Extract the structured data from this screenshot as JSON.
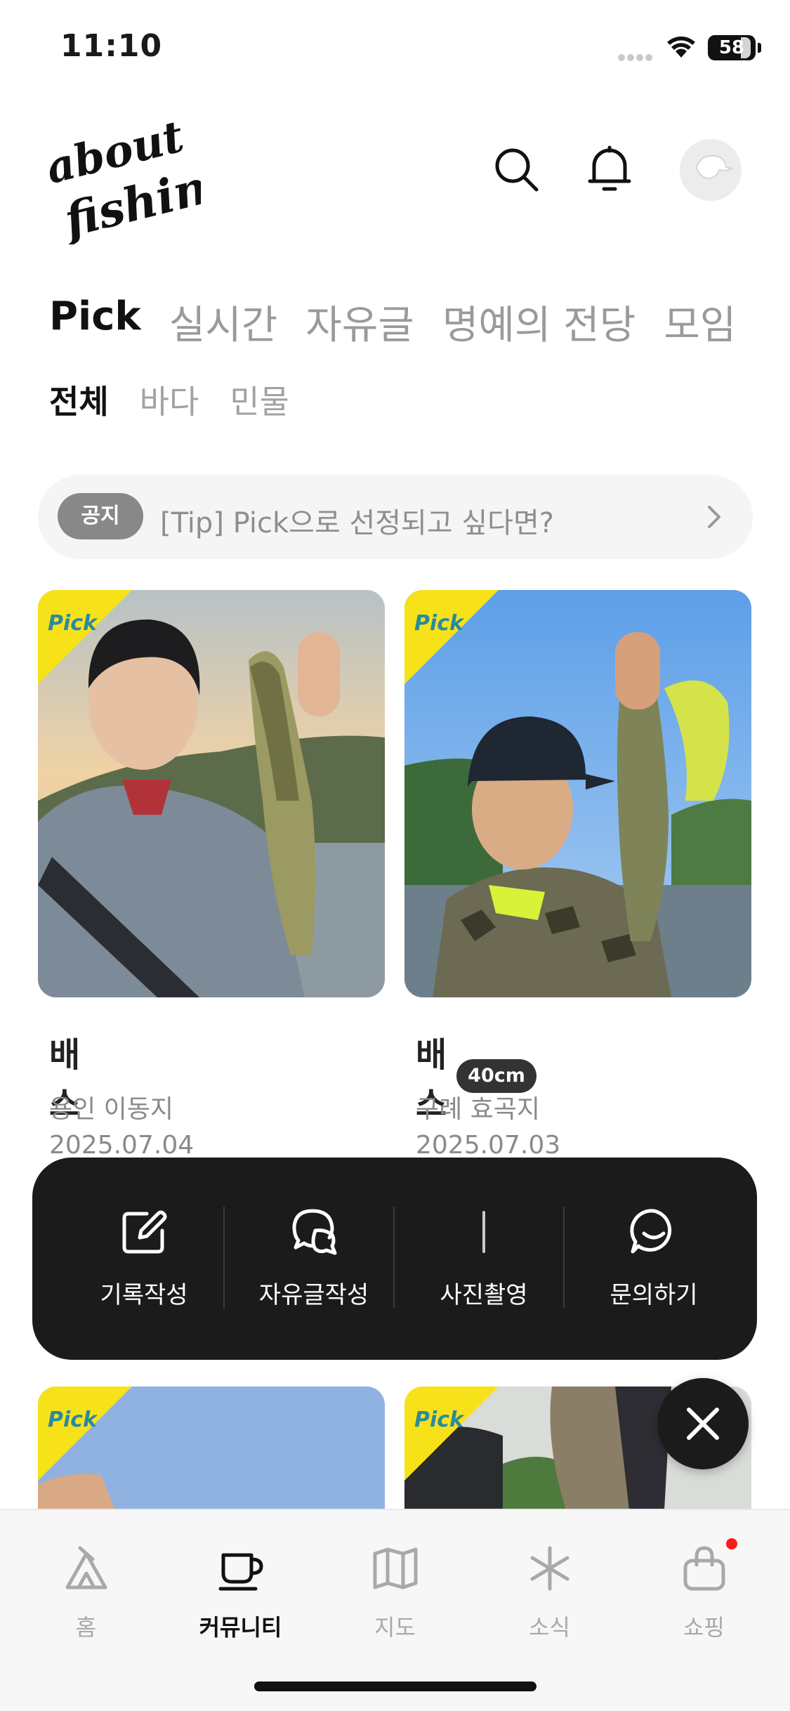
{
  "status": {
    "time": "11:10",
    "battery": "58"
  },
  "header": {
    "logo_line1": "about",
    "logo_line2": "fishing"
  },
  "main_tabs": [
    {
      "label": "Pick",
      "active": true
    },
    {
      "label": "실시간",
      "active": false
    },
    {
      "label": "자유글",
      "active": false
    },
    {
      "label": "명예의 전당",
      "active": false
    },
    {
      "label": "모임",
      "active": false
    }
  ],
  "sub_tabs": [
    {
      "label": "전체",
      "active": true
    },
    {
      "label": "바다",
      "active": false
    },
    {
      "label": "민물",
      "active": false
    }
  ],
  "notice": {
    "badge": "공지",
    "text": "[Tip] Pick으로 선정되고 싶다면?"
  },
  "cards": [
    {
      "pick": "Pick",
      "title": "배스",
      "size": "",
      "location": "용인 이동지",
      "date": "2025.07.04"
    },
    {
      "pick": "Pick",
      "title": "배스",
      "size": "40cm",
      "location": "구례 효곡지",
      "date": "2025.07.03"
    },
    {
      "pick": "Pick"
    },
    {
      "pick": "Pick"
    }
  ],
  "action_menu": [
    {
      "label": "기록작성",
      "icon": "edit-icon"
    },
    {
      "label": "자유글작성",
      "icon": "chat-bubble-icon"
    },
    {
      "label": "사진촬영",
      "icon": "camera-icon"
    },
    {
      "label": "문의하기",
      "icon": "smile-chat-icon"
    }
  ],
  "bottom_nav": [
    {
      "label": "홈",
      "icon": "tent-icon",
      "active": false
    },
    {
      "label": "커뮤니티",
      "icon": "cup-icon",
      "active": true
    },
    {
      "label": "지도",
      "icon": "map-icon",
      "active": false
    },
    {
      "label": "소식",
      "icon": "asterisk-icon",
      "active": false
    },
    {
      "label": "쇼핑",
      "icon": "shopping-bag-icon",
      "active": false
    }
  ],
  "colors": {
    "pick_yellow": "#f7e21a",
    "pick_text": "#2a8aa0",
    "menu_bg": "#1b1b1b",
    "badge_red": "#ff1a1a"
  }
}
